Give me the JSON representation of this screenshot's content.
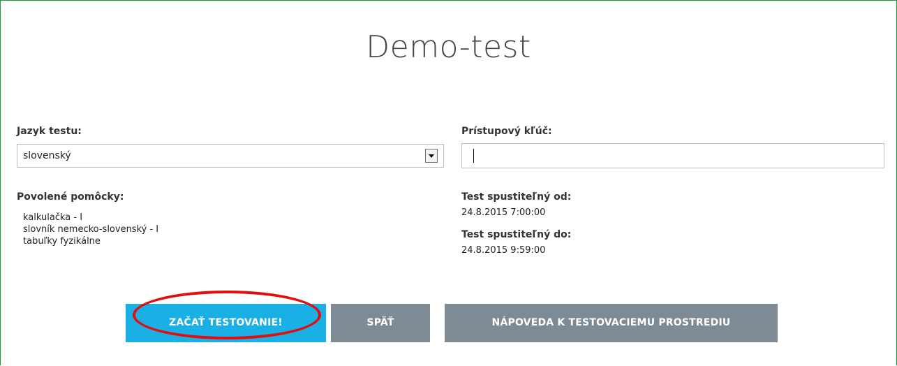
{
  "title": "Demo-test",
  "language": {
    "label": "Jazyk testu:",
    "selected": "slovenský"
  },
  "access_key": {
    "label": "Prístupový kľúč:",
    "value": ""
  },
  "aids": {
    "label": "Povolené pomôcky:",
    "items": [
      "kalkulačka - I",
      "slovník nemecko-slovenský - I",
      "tabuľky fyzikálne"
    ]
  },
  "availability": {
    "from_label": "Test spustiteľný od:",
    "from_value": "24.8.2015 7:00:00",
    "to_label": "Test spustiteľný do:",
    "to_value": "24.8.2015 9:59:00"
  },
  "buttons": {
    "start": "ZAČAŤ TESTOVANIE!",
    "back": "SPÄŤ",
    "help": "NÁPOVEDA K TESTOVACIEMU PROSTREDIU"
  },
  "colors": {
    "frame_border": "#1a9c3f",
    "start_button": "#1ab0e6",
    "secondary_button": "#7e8b95",
    "highlight_ellipse": "#e20d0d"
  }
}
